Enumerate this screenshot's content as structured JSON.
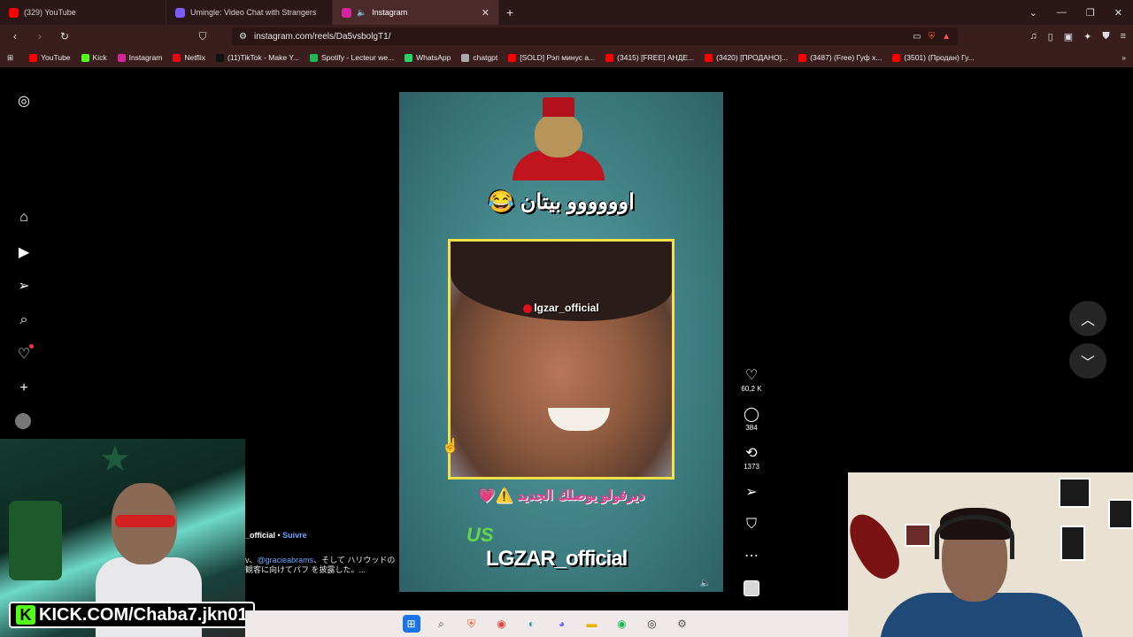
{
  "browser": {
    "tabs": [
      {
        "title": "(329) YouTube",
        "color": "#ff0000",
        "active": false
      },
      {
        "title": "Umingle: Video Chat with Strangers",
        "color": "#7a5cff",
        "active": false
      },
      {
        "title": "Instagram",
        "color": "#d6249f",
        "active": true
      }
    ],
    "new_tab": "+",
    "url": "instagram.com/reels/Da5vsbolgT1/",
    "bookmarks": [
      {
        "label": "YouTube",
        "color": "#ff0000"
      },
      {
        "label": "Kick",
        "color": "#53fc18"
      },
      {
        "label": "Instagram",
        "color": "#d6249f"
      },
      {
        "label": "Netflix",
        "color": "#e50914"
      },
      {
        "label": "(11)TikTok - Make Y...",
        "color": "#111111"
      },
      {
        "label": "Spotify - Lecteur we...",
        "color": "#1db954"
      },
      {
        "label": "WhatsApp",
        "color": "#25d366"
      },
      {
        "label": "chatgpt",
        "color": "#aaaaaa"
      },
      {
        "label": "[SOLD] Рэп минус a...",
        "color": "#ff0000"
      },
      {
        "label": "(3415) [FREE] АНДЕ...",
        "color": "#ff0000"
      },
      {
        "label": "(3420) [ПРОДАНО]...",
        "color": "#ff0000"
      },
      {
        "label": "(3487) (Free) Гуф x...",
        "color": "#ff0000"
      },
      {
        "label": "(3501) (Продан) Гу...",
        "color": "#ff0000"
      }
    ],
    "bookmarks_more": "»"
  },
  "reel": {
    "caption_top": "اوووووو بيتان 😂",
    "watermark_tag": "lgzar_official",
    "caption_mid": "ديرفولو يوصلك الجديد ⚠️💗",
    "logo_us": "US",
    "logo_name": "LGZAR_official",
    "likes": "60,2 K",
    "comments": "384",
    "reposts": "1373"
  },
  "post": {
    "username": "_official",
    "separator": " • ",
    "follow": "Suivre",
    "desc_prefix": "v、",
    "mention": "@gracieabrams",
    "desc_rest": "、そして ハリウッドの観客に向けてパフ を披露した。...",
    "more": ""
  },
  "stream": {
    "kick_letter": "K",
    "kick_label": "KICK.COM/Chaba7.jkn01"
  }
}
